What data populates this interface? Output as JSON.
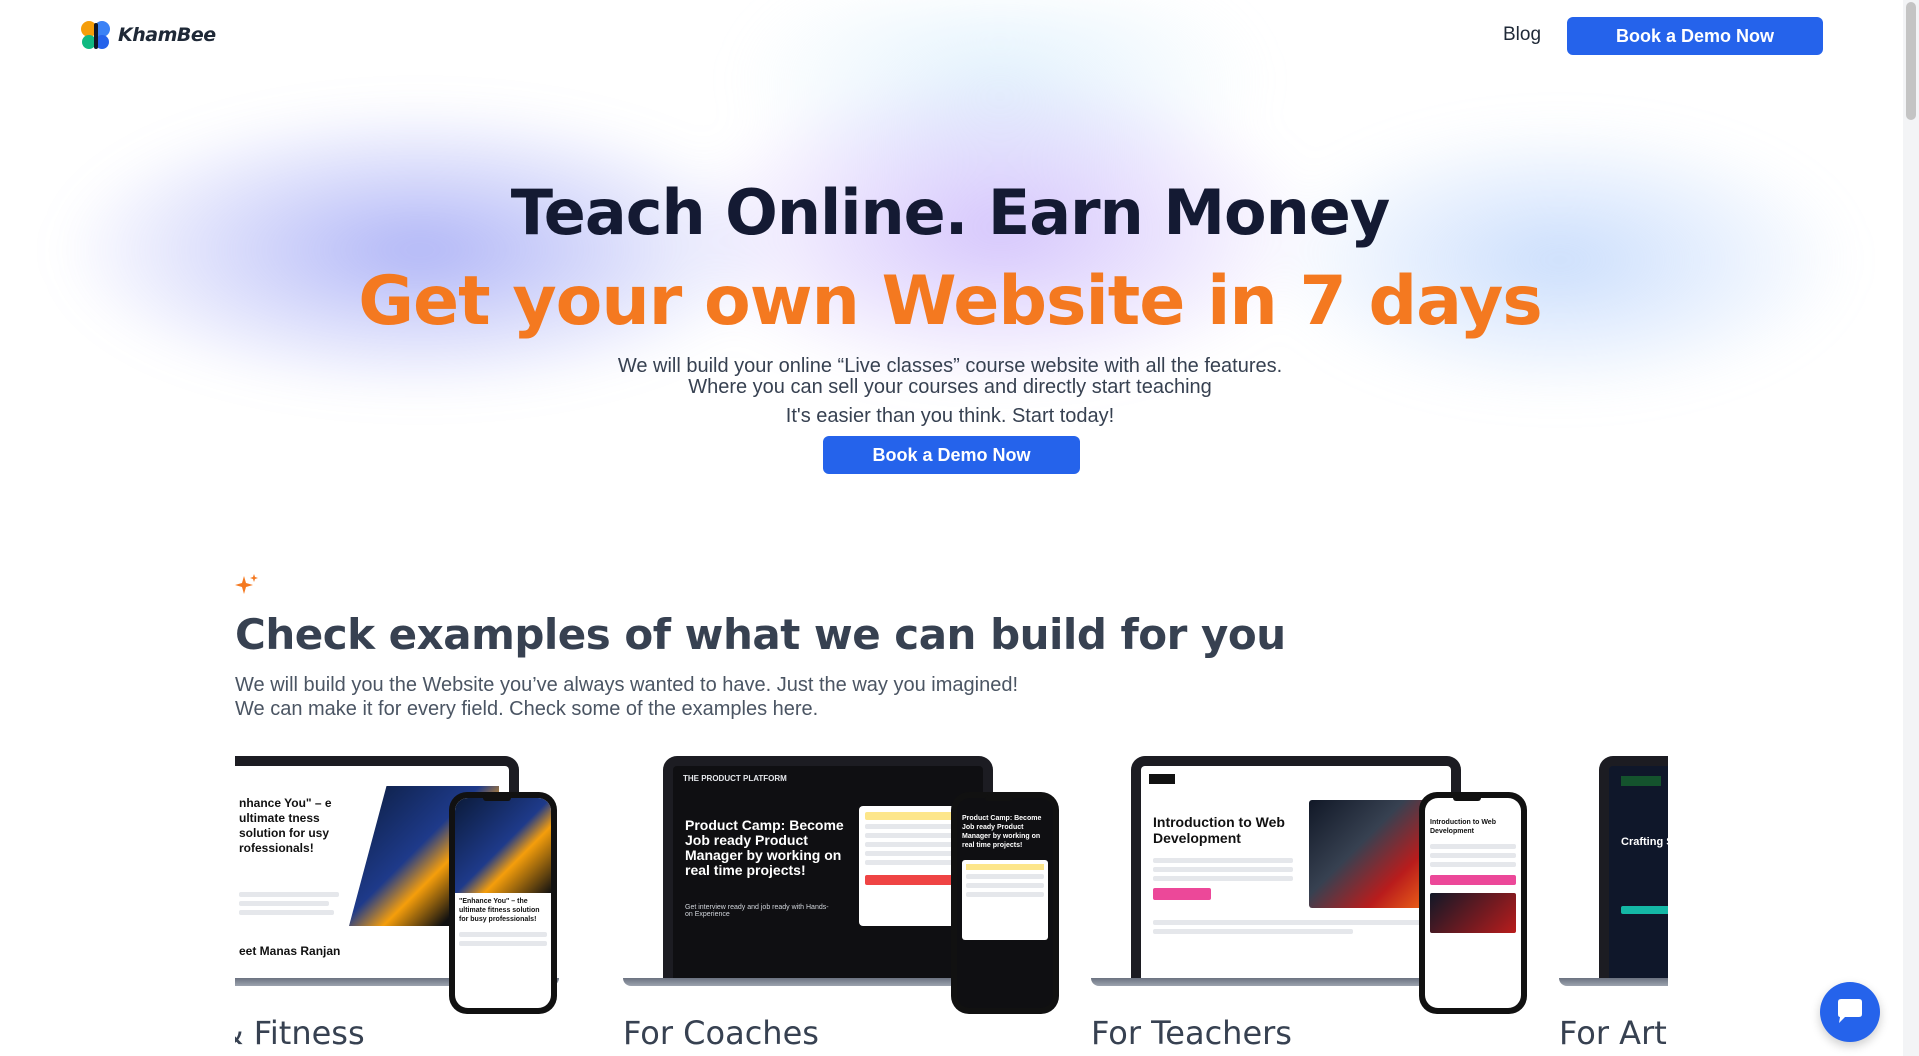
{
  "header": {
    "logo_text": "KhamBee",
    "nav_blog": "Blog",
    "cta_label": "Book a Demo Now"
  },
  "hero": {
    "title": "Teach Online. Earn Money",
    "subtitle": "Get your own Website in 7 days",
    "description": "We will build your online “Live classes” course website with all the features. Where you can sell your courses and directly start teaching",
    "note": "It's easier than you think. Start today!",
    "cta_label": "Book a Demo Now"
  },
  "examples": {
    "title": "Check examples of what we can build for you",
    "description_line1": "We will build you the Website you’ve always wanted to have. Just the way you imagined!",
    "description_line2": "We can make it for every field. Check some of the examples here.",
    "cards": [
      {
        "label": "oga & Fitness",
        "laptop_heading": "nhance You\" – e ultimate tness solution for usy rofessionals!",
        "laptop_footer": "eet Manas Ranjan",
        "phone_heading": "\"Enhance You\" – the ultimate fitness solution for busy professionals!"
      },
      {
        "label": "For Coaches",
        "laptop_brand": "THE PRODUCT PLATFORM",
        "laptop_heading": "Product Camp: Become Job ready Product Manager by working on real time projects!",
        "laptop_sub": "Get interview ready and job ready with Hands-on Experience",
        "phone_heading": "Product Camp: Become Job ready Product Manager by working on real time projects!"
      },
      {
        "label": "For Teachers",
        "laptop_heading": "Introduction to Web Development",
        "phone_heading": "Introduction to Web Development"
      },
      {
        "label": "For Arti",
        "laptop_heading": "Crafting St"
      }
    ]
  },
  "colors": {
    "primary": "#2563eb",
    "accent_orange": "#f47920",
    "heading_dark": "#141a33",
    "text_gray": "#374151"
  },
  "icons": {
    "sparkle": "sparkle-icon",
    "chat": "chat-icon"
  }
}
